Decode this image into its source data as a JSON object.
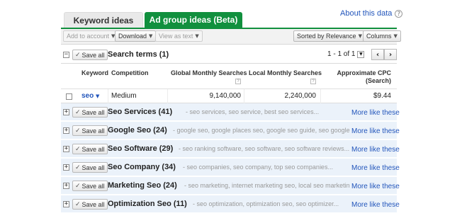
{
  "tabs": {
    "keyword_ideas": "Keyword ideas",
    "ad_group_ideas": "Ad group ideas (Beta)"
  },
  "about": {
    "label": "About this data",
    "help": "?"
  },
  "toolbar": {
    "add_to_account": "Add to account",
    "download": "Download",
    "view_as_text": "View as text",
    "sorted_by": "Sorted by Relevance",
    "columns": "Columns"
  },
  "search_terms": {
    "toggle": "−",
    "save_all": "Save all",
    "title": "Search terms (1)",
    "pager": "1 - 1 of 1",
    "prev": "‹",
    "next": "›"
  },
  "columns": {
    "keyword": "Keyword",
    "competition": "Competition",
    "global": "Global Monthly Searches",
    "local": "Local Monthly Searches",
    "cpc_line1": "Approximate CPC",
    "cpc_line2": "(Search)",
    "help": "?"
  },
  "keyword_row": {
    "keyword": "seo",
    "competition": "Medium",
    "global": "9,140,000",
    "local": "2,240,000",
    "cpc": "$9.44"
  },
  "groups": [
    {
      "name": "Seo Services (41)",
      "desc": "- seo services, seo service, best seo services...",
      "more": "More like these"
    },
    {
      "name": "Google Seo (24)",
      "desc": "- google seo, google places seo, google seo guide, seo google...",
      "more": "More like these"
    },
    {
      "name": "Seo Software (29)",
      "desc": "- seo ranking software, seo software, seo software reviews...",
      "more": "More like these"
    },
    {
      "name": "Seo Company (34)",
      "desc": "- seo companies, seo company, top seo companies...",
      "more": "More like these"
    },
    {
      "name": "Marketing Seo (24)",
      "desc": "- seo marketing, internet marketing seo, local seo marketing...",
      "more": "More like these"
    },
    {
      "name": "Optimization Seo (11)",
      "desc": "- seo optimization, optimization seo, seo optimizer...",
      "more": "More like these"
    }
  ],
  "group_controls": {
    "expand": "+",
    "save_all": "Save all"
  },
  "colors": {
    "accent_green": "#11903e",
    "link_blue": "#2255bb",
    "group_bg": "#ebf2fa"
  }
}
